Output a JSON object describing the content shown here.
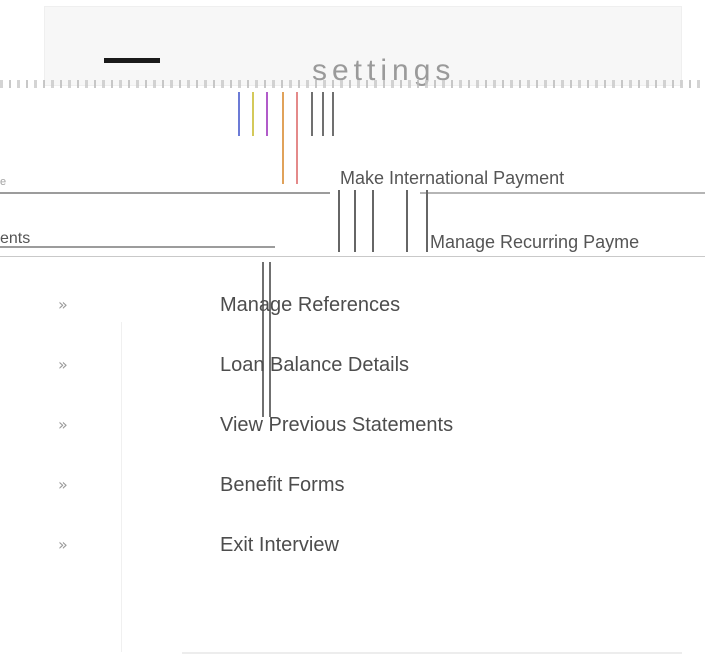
{
  "header": {
    "title": "settings"
  },
  "sub_rows": {
    "row1_left": "e",
    "row1_right": "Make International Payment",
    "row2_left": "ents",
    "row2_right": "Manage Recurring Payme"
  },
  "menu": {
    "chevron": "»",
    "items": [
      {
        "label": "Manage References"
      },
      {
        "label": "Loan Balance Details"
      },
      {
        "label": "View Previous Statements"
      },
      {
        "label": "Benefit Forms"
      },
      {
        "label": "Exit Interview"
      }
    ]
  },
  "colors": {
    "text": "#4d4d4d",
    "chevron": "#9b9b9b",
    "panel": "#f7f7f7"
  }
}
